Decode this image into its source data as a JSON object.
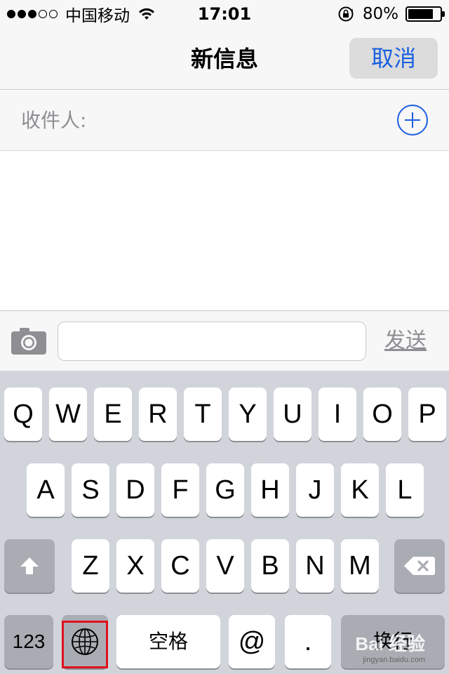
{
  "status_bar": {
    "carrier": "中国移动",
    "time": "17:01",
    "battery_percent": "80%",
    "battery_level": 0.8,
    "signal_bars_filled": 3,
    "signal_bars_total": 5
  },
  "nav": {
    "title": "新信息",
    "cancel_label": "取消"
  },
  "recipients": {
    "label": "收件人:"
  },
  "compose": {
    "message_value": "",
    "send_label": "发送"
  },
  "keyboard": {
    "row1": [
      "Q",
      "W",
      "E",
      "R",
      "T",
      "Y",
      "U",
      "I",
      "O",
      "P"
    ],
    "row2": [
      "A",
      "S",
      "D",
      "F",
      "G",
      "H",
      "J",
      "K",
      "L"
    ],
    "row3": [
      "Z",
      "X",
      "C",
      "V",
      "B",
      "N",
      "M"
    ],
    "numbers_label": "123",
    "space_label": "空格",
    "at_label": "@",
    "dot_label": ".",
    "return_label": "换行"
  },
  "watermark": {
    "text": "Bai 经验",
    "url": "jingyan.baidu.com"
  },
  "colors": {
    "accent": "#1a5fe0",
    "highlight": "#e0101f",
    "keyboard_bg": "#d1d5db"
  }
}
